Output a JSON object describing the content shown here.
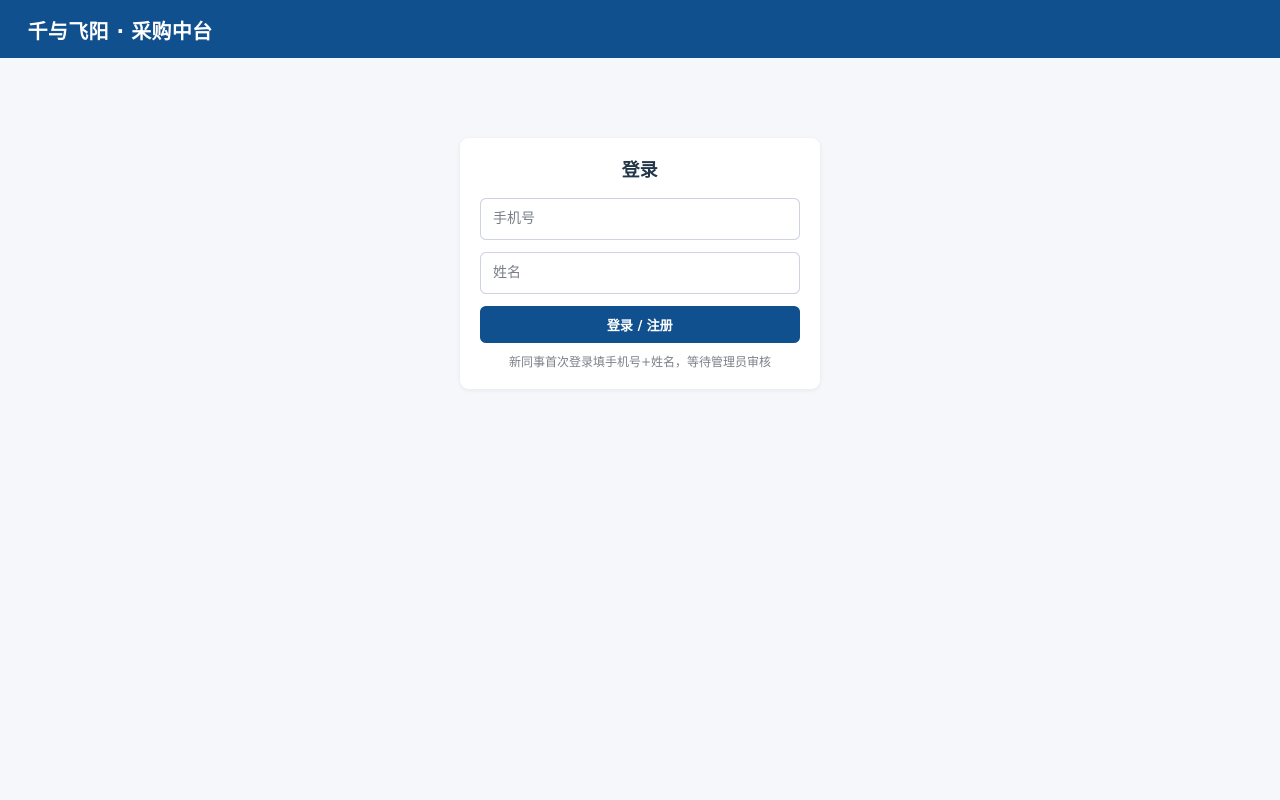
{
  "header": {
    "title": "千与飞阳 · 采购中台"
  },
  "login": {
    "title": "登录",
    "phone_placeholder": "手机号",
    "name_placeholder": "姓名",
    "submit_label": "登录 / 注册",
    "hint": "新同事首次登录填手机号+姓名，等待管理员审核"
  },
  "colors": {
    "brand": "#11508f",
    "background": "#f5f7fa"
  }
}
